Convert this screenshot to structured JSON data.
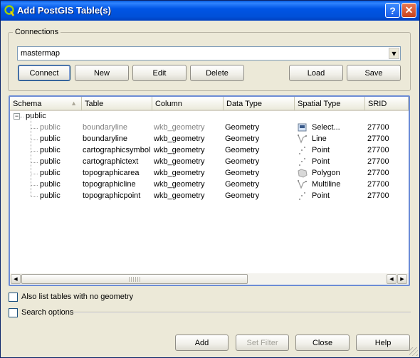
{
  "window": {
    "title": "Add PostGIS Table(s)",
    "help_glyph": "?",
    "close_glyph": "✕"
  },
  "connections": {
    "legend": "Connections",
    "selected": "mastermap",
    "buttons": {
      "connect": "Connect",
      "new": "New",
      "edit": "Edit",
      "delete": "Delete",
      "load": "Load",
      "save": "Save"
    }
  },
  "table": {
    "columns": [
      "Schema",
      "Table",
      "Column",
      "Data Type",
      "Spatial Type",
      "SRID"
    ],
    "group": {
      "expander": "−",
      "label": "public"
    },
    "rows": [
      {
        "schema": "public",
        "table": "boundaryline",
        "column": "wkb_geometry",
        "data_type": "Geometry",
        "spatial_type": "Select...",
        "srid": "27700",
        "icon": "select-icon",
        "greyed": true
      },
      {
        "schema": "public",
        "table": "boundaryline",
        "column": "wkb_geometry",
        "data_type": "Geometry",
        "spatial_type": "Line",
        "srid": "27700",
        "icon": "line-icon",
        "greyed": false
      },
      {
        "schema": "public",
        "table": "cartographicsymbol",
        "column": "wkb_geometry",
        "data_type": "Geometry",
        "spatial_type": "Point",
        "srid": "27700",
        "icon": "point-icon",
        "greyed": false
      },
      {
        "schema": "public",
        "table": "cartographictext",
        "column": "wkb_geometry",
        "data_type": "Geometry",
        "spatial_type": "Point",
        "srid": "27700",
        "icon": "point-icon",
        "greyed": false
      },
      {
        "schema": "public",
        "table": "topographicarea",
        "column": "wkb_geometry",
        "data_type": "Geometry",
        "spatial_type": "Polygon",
        "srid": "27700",
        "icon": "polygon-icon",
        "greyed": false
      },
      {
        "schema": "public",
        "table": "topographicline",
        "column": "wkb_geometry",
        "data_type": "Geometry",
        "spatial_type": "Multiline",
        "srid": "27700",
        "icon": "line-icon",
        "greyed": false
      },
      {
        "schema": "public",
        "table": "topographicpoint",
        "column": "wkb_geometry",
        "data_type": "Geometry",
        "spatial_type": "Point",
        "srid": "27700",
        "icon": "point-icon",
        "greyed": false
      }
    ]
  },
  "options": {
    "no_geometry": "Also list tables with no geometry",
    "search_options": "Search options"
  },
  "footer": {
    "add": "Add",
    "set_filter": "Set Filter",
    "close": "Close",
    "help": "Help"
  },
  "colors": {
    "titlebar": "#0055e5",
    "tree_border": "#6c8cd5",
    "greyed_text": "#808080"
  }
}
